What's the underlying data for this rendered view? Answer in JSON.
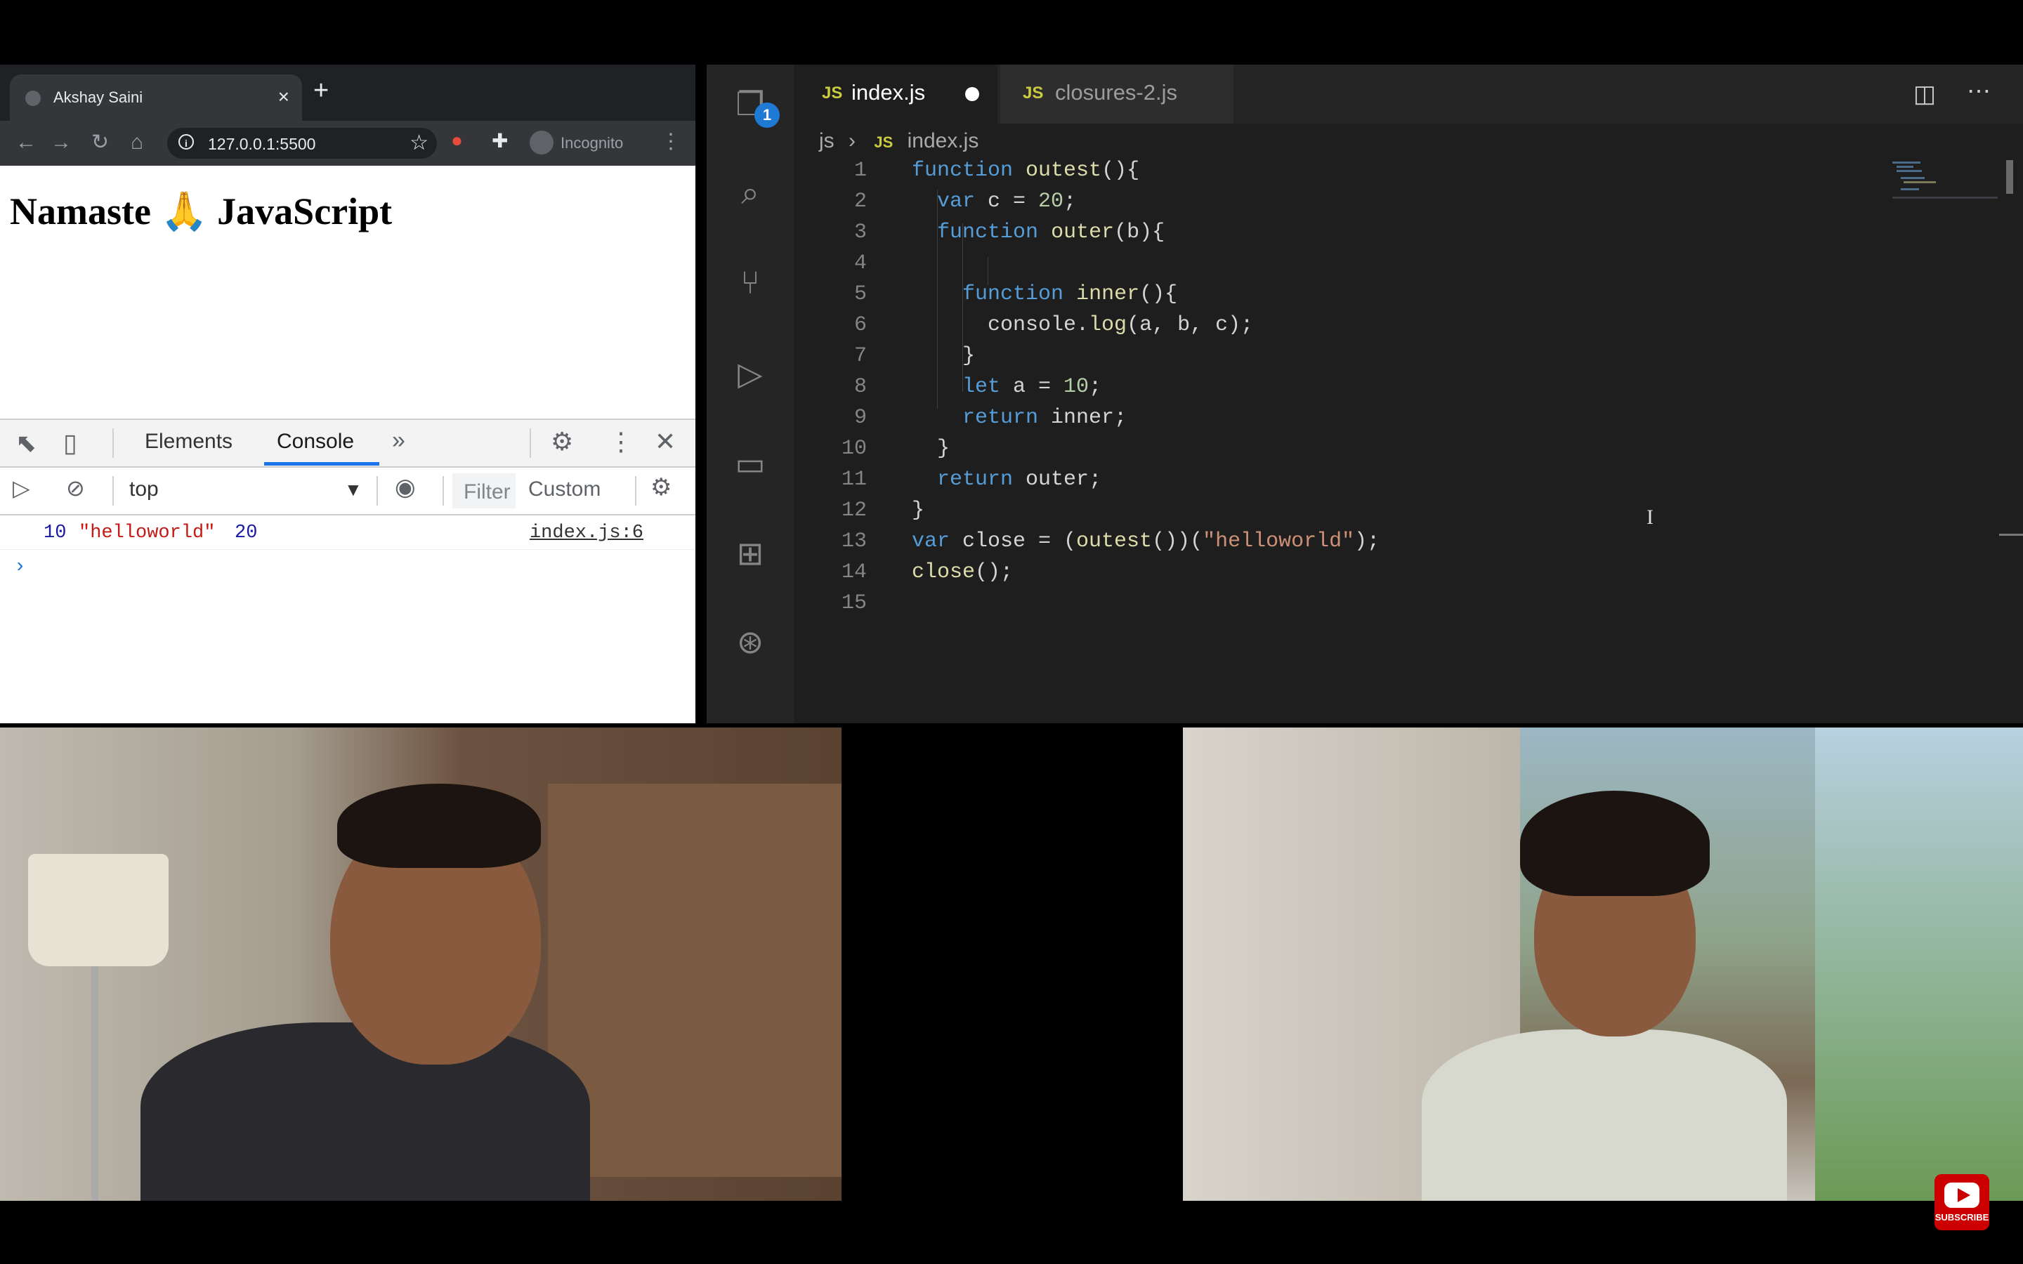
{
  "browser": {
    "tab_title": "Akshay Saini",
    "url": "127.0.0.1:5500",
    "incognito_label": "Incognito",
    "page_heading": "Namaste 🙏 JavaScript"
  },
  "devtools": {
    "tabs": [
      "Elements",
      "Console"
    ],
    "active_tab": "Console",
    "context": "top",
    "filter_placeholder": "Filter",
    "levels_label": "Custom",
    "log": {
      "num1": "10",
      "str": "\"helloworld\"",
      "num2": "20",
      "source": "index.js:6"
    },
    "prompt": "›"
  },
  "vscode": {
    "activity_badge": "1",
    "tabs": [
      {
        "icon": "JS",
        "name": "index.js",
        "modified": true,
        "active": true
      },
      {
        "icon": "JS",
        "name": "closures-2.js",
        "modified": false,
        "active": false
      }
    ],
    "breadcrumb": {
      "folder": "js",
      "icon": "JS",
      "file": "index.js"
    },
    "line_numbers": [
      "1",
      "2",
      "3",
      "4",
      "5",
      "6",
      "7",
      "8",
      "9",
      "10",
      "11",
      "12",
      "13",
      "14",
      "15"
    ],
    "code_lines": [
      "function outest(){",
      "  var c = 20;",
      "  function outer(b){",
      "",
      "    function inner(){",
      "      console.log(a, b, c);",
      "    }",
      "    let a = 10;",
      "    return inner;",
      "  }",
      "  return outer;",
      "}",
      "var close = (outest())(\"helloworld\");",
      "close();",
      ""
    ]
  },
  "youtube": {
    "subscribe_label": "SUBSCRIBE"
  }
}
